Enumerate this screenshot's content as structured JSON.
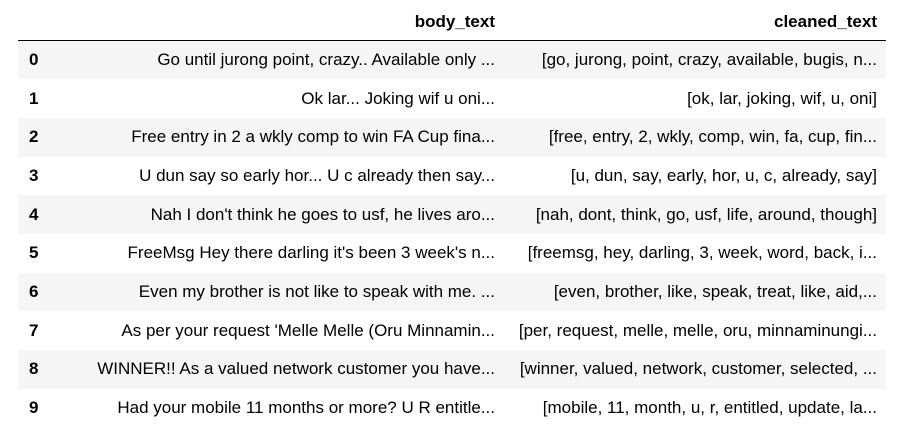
{
  "table": {
    "index_header": "",
    "columns": [
      "body_text",
      "cleaned_text"
    ],
    "rows": [
      {
        "index": "0",
        "body_text": "Go until jurong point, crazy.. Available only ...",
        "cleaned_text": "[go, jurong, point, crazy, available, bugis, n..."
      },
      {
        "index": "1",
        "body_text": "Ok lar... Joking wif u oni...",
        "cleaned_text": "[ok, lar, joking, wif, u, oni]"
      },
      {
        "index": "2",
        "body_text": "Free entry in 2 a wkly comp to win FA Cup fina...",
        "cleaned_text": "[free, entry, 2, wkly, comp, win, fa, cup, fin..."
      },
      {
        "index": "3",
        "body_text": "U dun say so early hor... U c already then say...",
        "cleaned_text": "[u, dun, say, early, hor, u, c, already, say]"
      },
      {
        "index": "4",
        "body_text": "Nah I don't think he goes to usf, he lives aro...",
        "cleaned_text": "[nah, dont, think, go, usf, life, around, though]"
      },
      {
        "index": "5",
        "body_text": "FreeMsg Hey there darling it's been 3 week's n...",
        "cleaned_text": "[freemsg, hey, darling, 3, week, word, back, i..."
      },
      {
        "index": "6",
        "body_text": "Even my brother is not like to speak with me. ...",
        "cleaned_text": "[even, brother, like, speak, treat, like, aid,..."
      },
      {
        "index": "7",
        "body_text": "As per your request 'Melle Melle (Oru Minnamin...",
        "cleaned_text": "[per, request, melle, melle, oru, minnaminungi..."
      },
      {
        "index": "8",
        "body_text": "WINNER!! As a valued network customer you have...",
        "cleaned_text": "[winner, valued, network, customer, selected, ..."
      },
      {
        "index": "9",
        "body_text": "Had your mobile 11 months or more? U R entitle...",
        "cleaned_text": "[mobile, 11, month, u, r, entitled, update, la..."
      }
    ]
  },
  "colors": {
    "row_stripe": "#f5f5f5",
    "row_plain": "#ffffff",
    "header_rule": "#000000",
    "text": "#000000"
  }
}
